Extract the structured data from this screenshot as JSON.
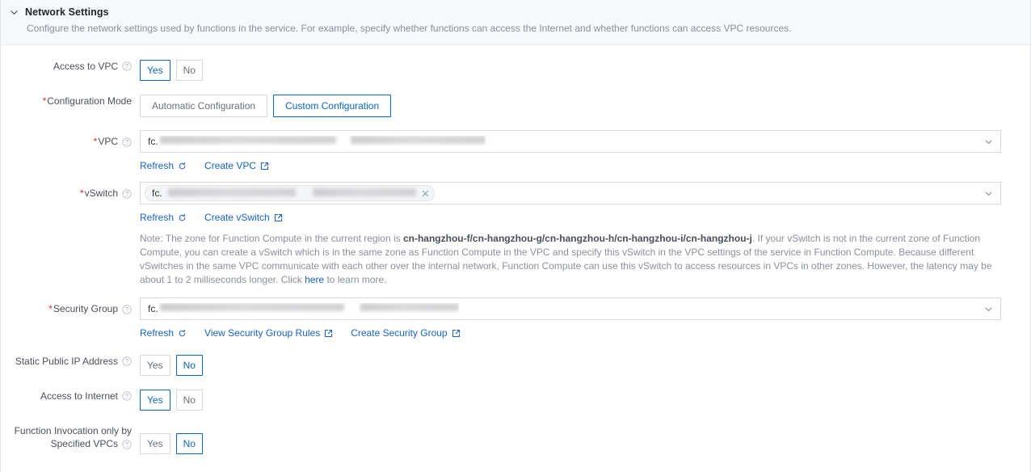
{
  "section": {
    "title": "Network Settings",
    "description": "Configure the network settings used by functions in the service. For example, specify whether functions can access the Internet and whether functions can access VPC resources.",
    "collapse_icon": "chevron-down-icon"
  },
  "rows": {
    "access_vpc": {
      "label": "Access to VPC",
      "required": false,
      "help_icon": "question-circle-icon",
      "options": [
        "Yes",
        "No"
      ],
      "selected": "Yes"
    },
    "configuration_mode": {
      "label": "Configuration Mode",
      "required": true,
      "options": [
        "Automatic Configuration",
        "Custom Configuration"
      ],
      "selected": "Custom Configuration"
    },
    "vpc": {
      "label": "VPC",
      "required": true,
      "help_icon": "question-circle-icon",
      "value_prefix": "fc.",
      "value_redacted": true,
      "dropdown_icon": "chevron-down-icon",
      "links": [
        {
          "label": "Refresh",
          "icon": "refresh-icon"
        },
        {
          "label": "Create VPC",
          "icon": "external-link-icon"
        }
      ]
    },
    "vswitch": {
      "label": "vSwitch",
      "required": true,
      "help_icon": "question-circle-icon",
      "tag_prefix": "fc.",
      "tag_redacted": true,
      "tag_remove_icon": "close-icon",
      "dropdown_icon": "chevron-down-icon",
      "links": [
        {
          "label": "Refresh",
          "icon": "refresh-icon"
        },
        {
          "label": "Create vSwitch",
          "icon": "external-link-icon"
        }
      ],
      "note": {
        "part1": "Note: The zone for Function Compute in the current region is ",
        "zones": "cn-hangzhou-f/cn-hangzhou-g/cn-hangzhou-h/cn-hangzhou-i/cn-hangzhou-j",
        "part2": ". If your vSwitch is not in the current zone of Function Compute, you can create a vSwitch which is in the same zone as Function Compute in the VPC and specify this vSwitch in the VPC settings of the service in Function Compute. Because different vSwitches in the same VPC communicate with each other over the internal network, Function Compute can use this vSwitch to access resources in VPCs in other zones. However, the latency may be about 1 to 2 milliseconds longer. Click ",
        "link": "here",
        "part3": " to learn more."
      }
    },
    "security_group": {
      "label": "Security Group",
      "required": true,
      "help_icon": "question-circle-icon",
      "value_prefix": "fc.",
      "value_redacted": true,
      "dropdown_icon": "chevron-down-icon",
      "links": [
        {
          "label": "Refresh",
          "icon": "refresh-icon"
        },
        {
          "label": "View Security Group Rules",
          "icon": "external-link-icon"
        },
        {
          "label": "Create Security Group",
          "icon": "external-link-icon"
        }
      ]
    },
    "static_public_ip": {
      "label": "Static Public IP Address",
      "required": false,
      "help_icon": "question-circle-icon",
      "options": [
        "Yes",
        "No"
      ],
      "selected": "No"
    },
    "access_internet": {
      "label": "Access to Internet",
      "required": false,
      "help_icon": "question-circle-icon",
      "options": [
        "Yes",
        "No"
      ],
      "selected": "Yes"
    },
    "invocation_specified_vpcs": {
      "label_line1": "Function Invocation only by",
      "label_line2": "Specified VPCs",
      "required": false,
      "help_icon": "question-circle-icon",
      "options": [
        "Yes",
        "No"
      ],
      "selected": "No"
    }
  },
  "colors": {
    "accent": "#0a66c2",
    "link": "#1763c6",
    "required": "#d93026",
    "header_bg": "#f7f8fa",
    "border": "#d5d8dd",
    "muted_text": "#8a8f99"
  }
}
